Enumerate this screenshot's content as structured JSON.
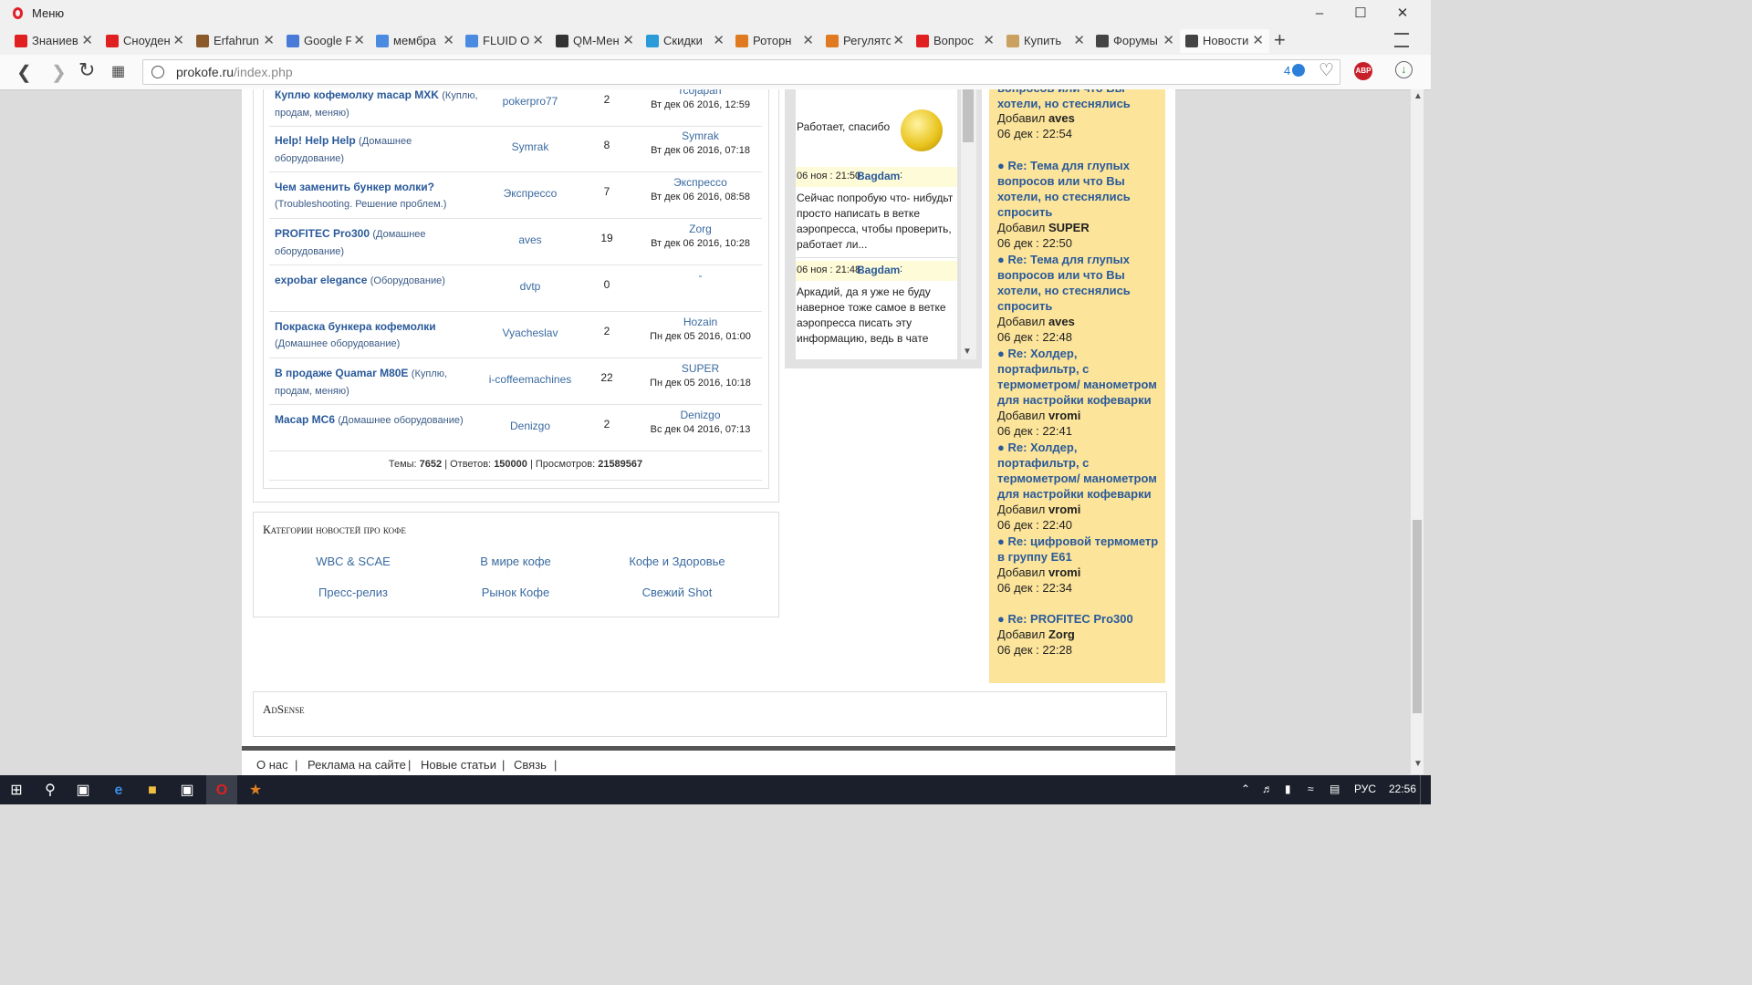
{
  "window": {
    "menu_label": "Меню",
    "minimize": "–",
    "maximize": "☐",
    "close": "✕"
  },
  "tabs": [
    {
      "label": "Знаниев",
      "color": "#e02020"
    },
    {
      "label": "Сноуден",
      "color": "#e02020"
    },
    {
      "label": "Erfahrun",
      "color": "#8a5a2a"
    },
    {
      "label": "Google F",
      "color": "#4a7ad8"
    },
    {
      "label": "мембра",
      "color": "#4a8ae0"
    },
    {
      "label": "FLUID O",
      "color": "#4a8ae0"
    },
    {
      "label": "QM-Мен",
      "color": "#333333"
    },
    {
      "label": "Скидки",
      "color": "#2a9ad8"
    },
    {
      "label": "Роторн",
      "color": "#e07a20"
    },
    {
      "label": "Регулято",
      "color": "#e07a20"
    },
    {
      "label": "Вопрос",
      "color": "#e02020"
    },
    {
      "label": "Купить",
      "color": "#caa060"
    },
    {
      "label": "Форумы",
      "color": "#444444"
    },
    {
      "label": "Новости",
      "color": "#444444"
    }
  ],
  "tab_close": "✕",
  "new_tab": "+",
  "address": {
    "host": "prokofe.ru",
    "path": "/index.php",
    "badge_count": "4",
    "abp": "ABP"
  },
  "forum_rows": [
    {
      "title": "Куплю кофемолку macap MXK",
      "cat": "(Куплю, продам, меняю)",
      "author": "pokerpro77",
      "replies": "2",
      "last_user": "rcojapan",
      "last_date": "Вт дек 06 2016, 12:59"
    },
    {
      "title": "Help! Help Help",
      "cat": "(Домашнее оборудование)",
      "author": "Symrak",
      "replies": "8",
      "last_user": "Symrak",
      "last_date": "Вт дек 06 2016, 07:18"
    },
    {
      "title": "Чем заменить бункер молки?",
      "cat": "(Troubleshooting. Решение проблем.)",
      "author": "Экспрессо",
      "replies": "7",
      "last_user": "Экспрессо",
      "last_date": "Вт дек 06 2016, 08:58"
    },
    {
      "title": "PROFITEC Pro300",
      "cat": "(Домашнее оборудование)",
      "author": "aves",
      "replies": "19",
      "last_user": "Zorg",
      "last_date": "Вт дек 06 2016, 10:28"
    },
    {
      "title": "expobar elegance",
      "cat": "(Оборудование)",
      "author": "dvtp",
      "replies": "0",
      "last_user": "-",
      "last_date": ""
    },
    {
      "title": "Покраска бункера кофемолки",
      "cat": "(Домашнее оборудование)",
      "author": "Vyacheslav",
      "replies": "2",
      "last_user": "Hozain",
      "last_date": "Пн дек 05 2016, 01:00"
    },
    {
      "title": "В продаже Quamar M80E",
      "cat": "(Куплю, продам, меняю)",
      "author": "i-coffeemachines",
      "replies": "22",
      "last_user": "SUPER",
      "last_date": "Пн дек 05 2016, 10:18"
    },
    {
      "title": "Macap MC6",
      "cat": "(Домашнее оборудование)",
      "author": "Denizgo",
      "replies": "2",
      "last_user": "Denizgo",
      "last_date": "Вс дек 04 2016, 07:13"
    }
  ],
  "stats": {
    "topics_label": "Темы:",
    "topics": "7652",
    "replies_label": "| Ответов:",
    "replies": "150000",
    "views_label": "| Просмотров:",
    "views": "21589567"
  },
  "categories": {
    "title": "Категории новостей про кофе",
    "links": [
      "WBC & SCAE",
      "В мире кофе",
      "Кофе и Здоровье",
      "Пресс-релиз",
      "Рынок Кофе",
      "Свежий Shot"
    ]
  },
  "adsense_title": "AdSense",
  "footer_links": [
    "О нас",
    "|",
    "Реклама на сайте",
    "|",
    "Новые статьи",
    "|",
    "Связь",
    "|"
  ],
  "chat": {
    "top_text": "Работает, спасибо",
    "messages": [
      {
        "time": "06 ноя : 21:50",
        "user": "Bagdam",
        "text": "Сейчас попробую что- нибудьт просто написать в ветке аэропресса, чтобы проверить, работает ли..."
      },
      {
        "time": "06 ноя : 21:48",
        "user": "Bagdam",
        "text": "Аркадий, да я уже не буду наверное тоже самое в ветке аэропресса писать эту информацию, ведь в чате"
      }
    ],
    "colon": ":"
  },
  "recent": {
    "top_partial": "вопросов или что Вы хотели, но стеснялись спросить",
    "top_added": "Добавил",
    "top_user": "aves",
    "top_time": "06 дек : 22:54",
    "items": [
      {
        "title": "Re: Тема для глупых вопросов или что Вы хотели, но стеснялись спросить",
        "user": "SUPER",
        "time": "06 дек : 22:50"
      },
      {
        "title": "Re: Тема для глупых вопросов или что Вы хотели, но стеснялись спросить",
        "user": "aves",
        "time": "06 дек : 22:48"
      },
      {
        "title": "Re: Холдер, портафильтр, с термометром/ манометром для настройки кофеварки",
        "user": "vromi",
        "time": "06 дек : 22:41"
      },
      {
        "title": "Re: Холдер, портафильтр, с термометром/ манометром для настройки кофеварки",
        "user": "vromi",
        "time": "06 дек : 22:40"
      },
      {
        "title": "Re: цифровой термометр в группу E61",
        "user": "vromi",
        "time": "06 дек : 22:34"
      },
      {
        "title": "Re: PROFITEC Pro300",
        "user": "Zorg",
        "time": "06 дек : 22:28"
      }
    ],
    "added_label": "Добавил",
    "bullet": "●"
  },
  "taskbar": {
    "lang": "РУС",
    "time": "22:56"
  }
}
